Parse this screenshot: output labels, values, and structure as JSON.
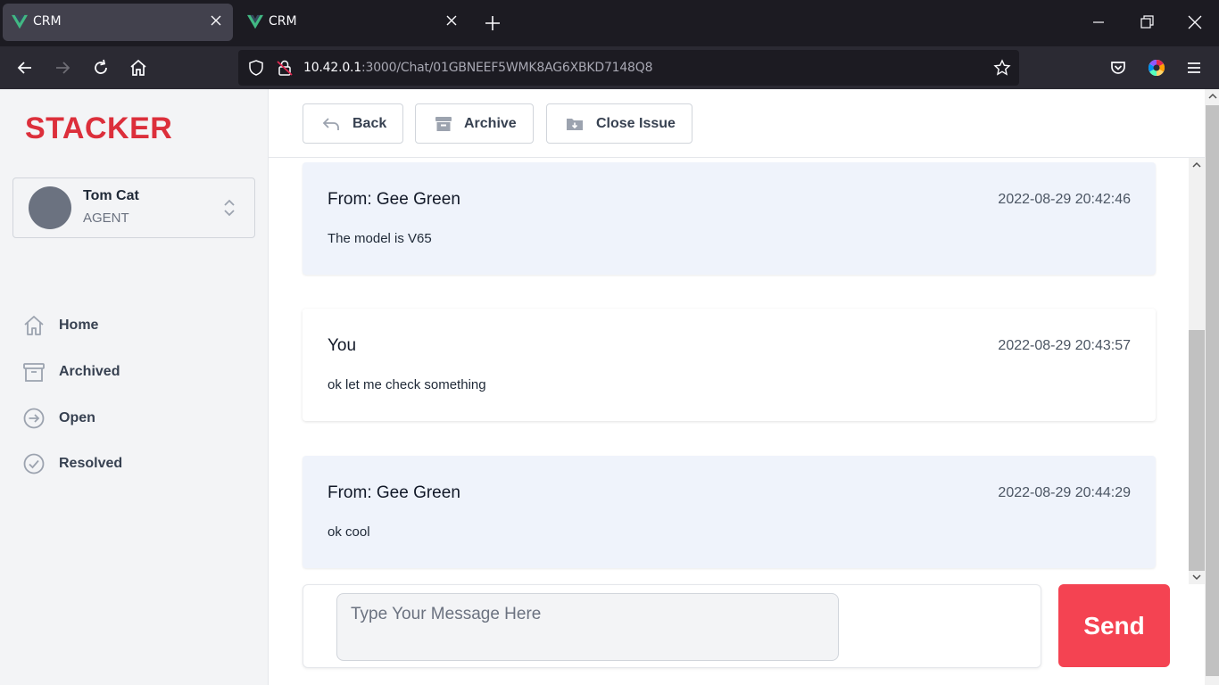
{
  "browser": {
    "tabs": [
      {
        "title": "CRM",
        "active": true
      },
      {
        "title": "CRM",
        "active": false
      }
    ],
    "url": {
      "host": "10.42.0.1",
      "rest": ":3000/Chat/01GBNEEF5WMK8AG6XBKD7148Q8"
    }
  },
  "sidebar": {
    "logo": "STACKER",
    "user": {
      "name": "Tom Cat",
      "role": "AGENT"
    },
    "items": [
      {
        "label": "Home",
        "icon": "home-icon"
      },
      {
        "label": "Archived",
        "icon": "archive-icon"
      },
      {
        "label": "Open",
        "icon": "arrow-right-circle-icon"
      },
      {
        "label": "Resolved",
        "icon": "check-circle-icon"
      }
    ]
  },
  "toolbar": {
    "back_label": "Back",
    "archive_label": "Archive",
    "close_label": "Close Issue"
  },
  "messages": [
    {
      "sender": "From: Gee Green",
      "time": "2022-08-29 20:42:46",
      "body": "The model is V65",
      "kind": "from"
    },
    {
      "sender": "You",
      "time": "2022-08-29 20:43:57",
      "body": "ok let me check something",
      "kind": "you"
    },
    {
      "sender": "From: Gee Green",
      "time": "2022-08-29 20:44:29",
      "body": "ok cool",
      "kind": "from"
    }
  ],
  "composer": {
    "placeholder": "Type Your Message Here",
    "value": "",
    "send_label": "Send"
  },
  "colors": {
    "brand": "#dc2f3b",
    "send": "#f44352",
    "from_bg": "#eff3fb"
  }
}
